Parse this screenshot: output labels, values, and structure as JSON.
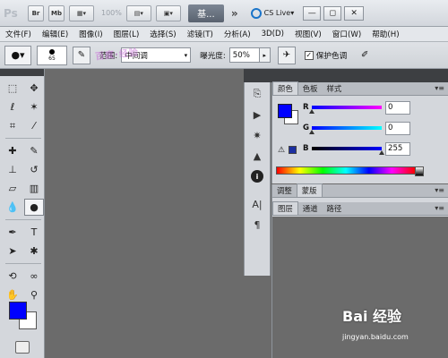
{
  "appbar": {
    "logo": "Ps",
    "bridge": "Br",
    "minibridge": "Mb",
    "zoom": "100%",
    "workspace": "基...",
    "more": "»",
    "cslive": "CS Live",
    "minimize": "—",
    "restore": "◻",
    "close": "✕"
  },
  "menu": [
    "文件(F)",
    "编辑(E)",
    "图像(I)",
    "图层(L)",
    "选择(S)",
    "滤镜(T)",
    "分析(A)",
    "3D(D)",
    "视图(V)",
    "窗口(W)",
    "帮助(H)"
  ],
  "options": {
    "brush_size": "65",
    "range_label": "范围:",
    "range_value": "中间调",
    "exposure_label": "曝光度:",
    "exposure_value": "50%",
    "protect_label": "保护色调",
    "watermark": "百度·经验"
  },
  "toolbox": {
    "fg_color": "#0000ff",
    "bg_color": "#ffffff"
  },
  "color_panel": {
    "tabs": [
      "颜色",
      "色板",
      "样式"
    ],
    "r_label": "R",
    "g_label": "G",
    "b_label": "B",
    "r_value": "0",
    "g_value": "0",
    "b_value": "255"
  },
  "adjust_panel": {
    "tabs": [
      "调整",
      "蒙版"
    ]
  },
  "layers_panel": {
    "tabs": [
      "图层",
      "通道",
      "路径"
    ]
  },
  "watermark": {
    "brand": "Bai 经验",
    "url": "jingyan.baidu.com"
  }
}
